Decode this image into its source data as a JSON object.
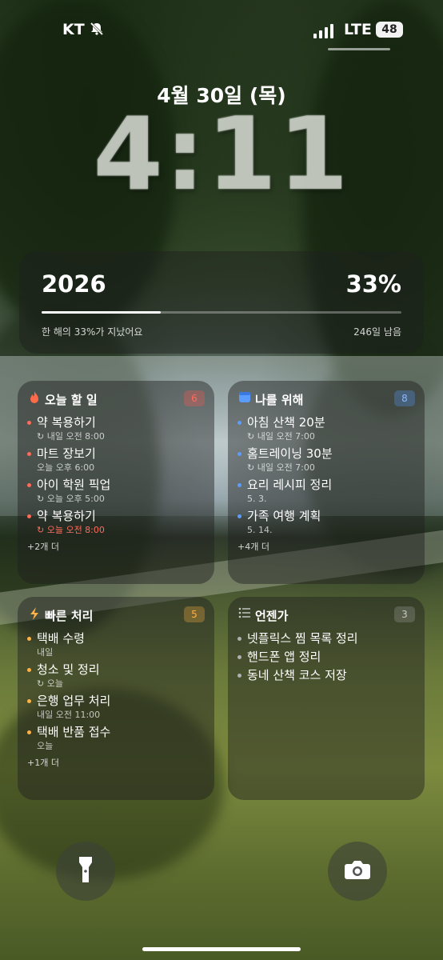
{
  "status": {
    "carrier": "KT",
    "network": "LTE",
    "battery": "48"
  },
  "lock": {
    "date": "4월 30일 (목)",
    "time": "4:11"
  },
  "year_widget": {
    "year": "2026",
    "percent": "33%",
    "progress_fraction": 0.33,
    "note": "한 해의 33%가 지났어요",
    "remaining": "246일 남음"
  },
  "cards": [
    {
      "title": "오늘 할 일",
      "count": "6",
      "accent": "#ff6b5a",
      "items": [
        {
          "text": "약 복용하기",
          "sub": "↻ 내일 오전 8:00"
        },
        {
          "text": "마트 장보기",
          "sub": "오늘 오후 6:00"
        },
        {
          "text": "아이 학원 픽업",
          "sub": "↻ 오늘 오후 5:00"
        },
        {
          "text": "약 복용하기",
          "sub": "↻ 오늘 오전 8:00",
          "sub_color": "#ff6b5a"
        }
      ],
      "more": "+2개 더"
    },
    {
      "title": "나를 위해",
      "count": "8",
      "accent": "#5a9cff",
      "items": [
        {
          "text": "아침 산책 20분",
          "sub": "↻ 내일 오전 7:00"
        },
        {
          "text": "홈트레이닝 30분",
          "sub": "↻ 내일 오전 7:00"
        },
        {
          "text": "요리 레시피 정리",
          "sub": "5. 3."
        },
        {
          "text": "가족 여행 계획",
          "sub": "5. 14."
        }
      ],
      "more": "+4개 더"
    },
    {
      "title": "빠른 처리",
      "count": "5",
      "accent": "#ffb347",
      "items": [
        {
          "text": "택배 수령",
          "sub": "내일"
        },
        {
          "text": "청소 및 정리",
          "sub": "↻ 오늘"
        },
        {
          "text": "은행 업무 처리",
          "sub": "내일 오전 11:00"
        },
        {
          "text": "택배 반품 접수",
          "sub": "오늘"
        }
      ],
      "more": "+1개 더"
    },
    {
      "title": "언젠가",
      "count": "3",
      "accent": "#b0b0b0",
      "items": [
        {
          "text": "넷플릭스 찜 목록 정리",
          "sub": ""
        },
        {
          "text": "핸드폰 앱 정리",
          "sub": ""
        },
        {
          "text": "동네 산책 코스 저장",
          "sub": ""
        }
      ],
      "more": ""
    }
  ]
}
